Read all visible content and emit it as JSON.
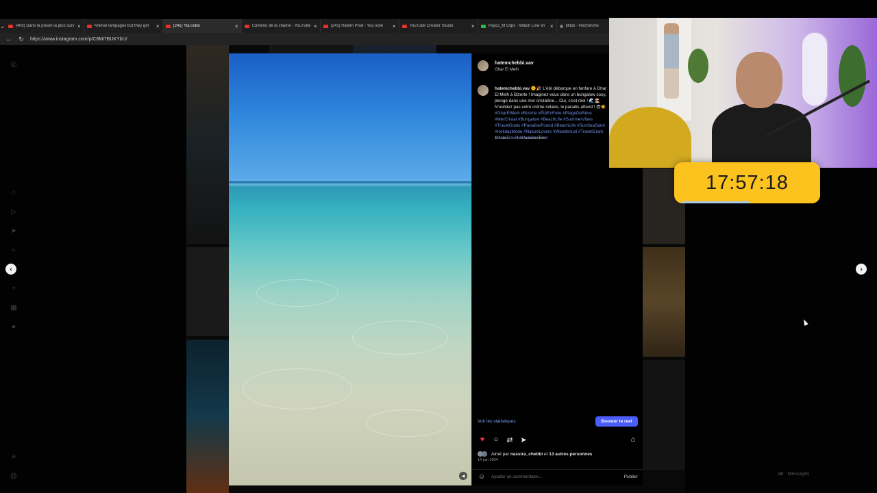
{
  "browser": {
    "tabs": [
      {
        "title": "(409) Dans la prison la plus surv",
        "fav": "red",
        "active": false
      },
      {
        "title": "Animal rampages but they get",
        "fav": "red",
        "active": false
      },
      {
        "title": "(241) YouTube",
        "fav": "red",
        "active": true
      },
      {
        "title": "Contenu de la chaîne - YouTube",
        "fav": "red",
        "active": false
      },
      {
        "title": "(241) Hatem Prod - YouTube",
        "fav": "red",
        "active": false
      },
      {
        "title": "YouTube Creator Studio",
        "fav": "red",
        "active": false
      },
      {
        "title": "Psyco_M Clips - Watch Live on",
        "fav": "green",
        "active": false
      },
      {
        "title": "tiktok - Recherche",
        "fav": "grey",
        "active": false
      }
    ],
    "tab_close_glyph": "×",
    "url": "https://www.instagram.com/p/C8Mi7BUKYbU/"
  },
  "post": {
    "username": "hatemchebbi.vav",
    "location": "Ghar El Melh",
    "caption_user": "hatemchebbi.vav",
    "caption_text": "🌞🎉 L'été débarque en fanfare à Ghar El Melh à Bizerte ! Imaginez-vous dans un bungalow cosy, plongé dans une mer cristalline... Oui, c'est réel ! 🌊🏖️ N'oubliez pas votre crème solaire, le paradis attend ! 😎☀️",
    "caption_tags": "#GharElMelh #Bizerte #ÉtéEnFolie #PlageDeRêve #MerCristal #Bungalow #BeachLife #SummerVibes #TravelGoals #ParadiseFound #BeachLife #SunSeaSand #HolidayMode #NatureLovers #Wanderlust #TravelGram #InstaTravel #VacationTime",
    "time_ago": "114 sem",
    "translate_label": "Voir la traduction",
    "stats_link": "Voir les statistiques",
    "boost_label": "Booster le reel",
    "liked_prefix": "Aimé par",
    "liked_user": "nassira_chebbi",
    "liked_joiner": "et",
    "liked_others": "13 autres personnes",
    "date": "14 juin 2024",
    "comment_placeholder": "Ajouter un commentaire...",
    "publish_label": "Publier"
  },
  "icons": {
    "heart": "♥",
    "comment": "○",
    "share": "⇄",
    "send": "➤",
    "bookmark": "⌂",
    "emoji": "☺",
    "prev": "‹",
    "next": "›",
    "mute": "◀"
  },
  "timer": {
    "display": "17:57:18",
    "progress": 0.52
  },
  "messages_label": "Messages",
  "colors": {
    "accent": "#4a5df9",
    "timer": "#fcc31f",
    "like": "#ff3040",
    "link": "#7fa7ff"
  }
}
